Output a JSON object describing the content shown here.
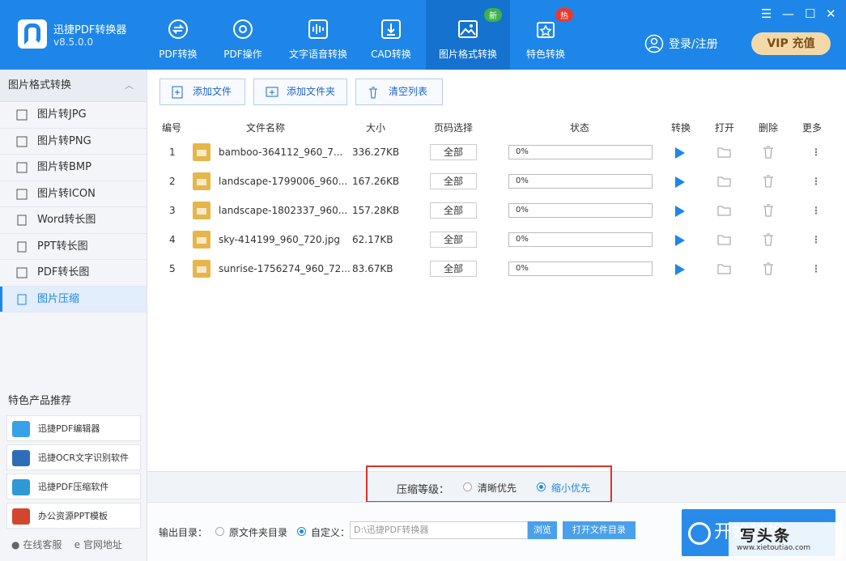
{
  "app": {
    "name": "迅捷PDF转换器",
    "version": "v8.5.0.0"
  },
  "nav": [
    {
      "label": "PDF转换",
      "icon": "convert-icon"
    },
    {
      "label": "PDF操作",
      "icon": "gear-icon"
    },
    {
      "label": "文字语音转换",
      "icon": "audio-wave-icon"
    },
    {
      "label": "CAD转换",
      "icon": "cad-icon"
    },
    {
      "label": "图片格式转换",
      "icon": "image-icon",
      "badge": "新",
      "active": true
    },
    {
      "label": "特色转换",
      "icon": "star-swap-icon",
      "badge": "热"
    }
  ],
  "window": {
    "menu": "☰",
    "minimize": "—",
    "maximize": "☐",
    "close": "✕"
  },
  "account": {
    "login": "登录/注册",
    "vip": "VIP 充值"
  },
  "sidebar": {
    "title": "图片格式转换",
    "items": [
      {
        "label": "图片转JPG"
      },
      {
        "label": "图片转PNG"
      },
      {
        "label": "图片转BMP"
      },
      {
        "label": "图片转ICON"
      },
      {
        "label": "Word转长图"
      },
      {
        "label": "PPT转长图"
      },
      {
        "label": "PDF转长图"
      },
      {
        "label": "图片压缩",
        "active": true
      }
    ],
    "recommend_title": "特色产品推荐",
    "recommend": [
      {
        "label": "迅捷PDF编辑器"
      },
      {
        "label": "迅捷OCR文字识别软件"
      },
      {
        "label": "迅捷PDF压缩软件"
      },
      {
        "label": "办公资源PPT模板"
      }
    ],
    "online_service": "在线客服",
    "website": "官网地址"
  },
  "toolbar": {
    "add_file": "添加文件",
    "add_folder": "添加文件夹",
    "clear_list": "清空列表"
  },
  "table": {
    "headers": {
      "num": "编号",
      "name": "文件名称",
      "size": "大小",
      "pages": "页码选择",
      "status": "状态",
      "convert": "转换",
      "open": "打开",
      "delete": "删除",
      "more": "更多"
    },
    "rows": [
      {
        "num": "1",
        "name": "bamboo-364112_960_7...",
        "size": "336.27KB",
        "pages": "全部",
        "progress": "0%"
      },
      {
        "num": "2",
        "name": "landscape-1799006_960...",
        "size": "167.26KB",
        "pages": "全部",
        "progress": "0%"
      },
      {
        "num": "3",
        "name": "landscape-1802337_960...",
        "size": "157.28KB",
        "pages": "全部",
        "progress": "0%"
      },
      {
        "num": "4",
        "name": "sky-414199_960_720.jpg",
        "size": "62.17KB",
        "pages": "全部",
        "progress": "0%"
      },
      {
        "num": "5",
        "name": "sunrise-1756274_960_72...",
        "size": "83.67KB",
        "pages": "全部",
        "progress": "0%"
      }
    ]
  },
  "compress": {
    "label": "压缩等级：",
    "opt1": "清晰优先",
    "opt2": "缩小优先",
    "selected": "缩小优先"
  },
  "output": {
    "label": "输出目录：",
    "opt_original": "原文件夹目录",
    "opt_custom": "自定义：",
    "path": "D:\\迅捷PDF转换器",
    "browse": "浏览",
    "open_dir": "打开文件目录",
    "selected": "自定义"
  },
  "start": {
    "label": "开始转换"
  },
  "watermark": {
    "title": "写头条",
    "site": "www.xietoutiao.com"
  }
}
